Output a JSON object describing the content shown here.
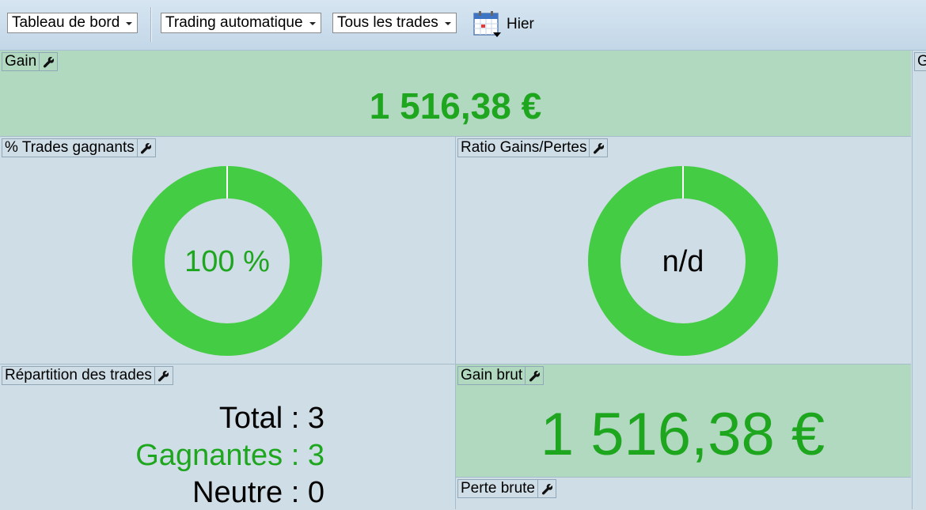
{
  "toolbar": {
    "dashboard_menu": "Tableau de bord",
    "trading_menu": "Trading automatique",
    "trades_filter": "Tous les trades",
    "date_label": "Hier",
    "calendar_icon": "calendar-dropdown-icon"
  },
  "panels": {
    "gain": {
      "title": "Gain",
      "value": "1 516,38 €"
    },
    "win_rate": {
      "title": "% Trades gagnants",
      "center": "100 %",
      "fraction": 1.0,
      "ring_color": "#44cc44"
    },
    "ratio": {
      "title": "Ratio Gains/Pertes",
      "center": "n/d",
      "fraction": 1.0,
      "ring_color": "#44cc44"
    },
    "distribution": {
      "title": "Répartition des trades",
      "rows": [
        {
          "label": "Total",
          "sep": " : ",
          "value": "3",
          "color": "#000000"
        },
        {
          "label": "Gagnantes",
          "sep": " : ",
          "value": "3",
          "color": "#1ea61e"
        },
        {
          "label": "Neutre",
          "sep": " : ",
          "value": "0",
          "color": "#000000"
        }
      ]
    },
    "gross_gain": {
      "title": "Gain brut",
      "value": "1 516,38 €"
    },
    "gross_loss": {
      "title": "Perte brute"
    },
    "right_stub": {
      "title": "G"
    }
  },
  "colors": {
    "accent_green": "#1ea61e",
    "panel_green": "#b0d9c0",
    "panel_blue": "#cfdde6",
    "ring_green": "#44cc44"
  },
  "icons": {
    "panel_settings": "wrench-icon"
  }
}
